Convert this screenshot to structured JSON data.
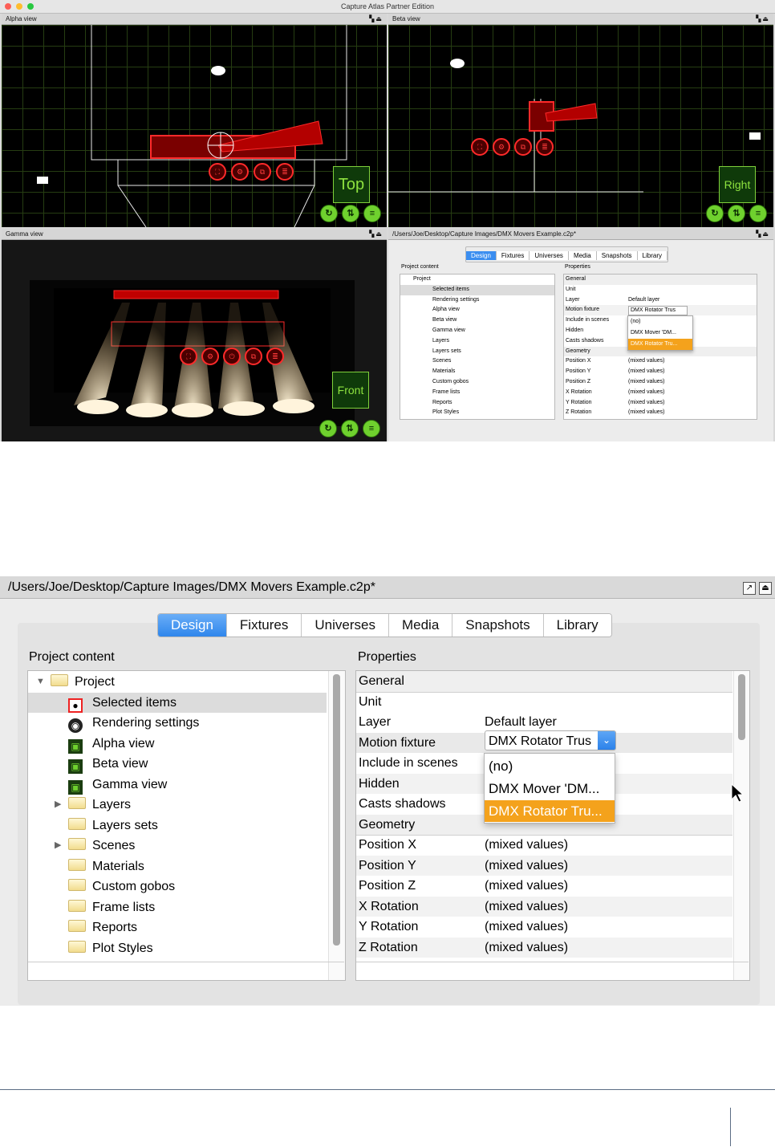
{
  "app": {
    "title": "Capture Atlas Partner Edition"
  },
  "views": {
    "alpha": {
      "header": "Alpha view",
      "label_button": "Top"
    },
    "beta": {
      "header": "Beta view",
      "label_button": "Right"
    },
    "gamma": {
      "header": "Gamma view",
      "label_button": "Front"
    },
    "project": {
      "header": "/Users/Joe/Desktop/Capture Images/DMX Movers Example.c2p*"
    }
  },
  "panel": {
    "title": "/Users/Joe/Desktop/Capture Images/DMX Movers Example.c2p*",
    "tabs": [
      "Design",
      "Fixtures",
      "Universes",
      "Media",
      "Snapshots",
      "Library"
    ],
    "active_tab": "Design",
    "project_content_label": "Project content",
    "properties_label": "Properties",
    "tree": [
      {
        "label": "Project",
        "icon": "folder-icon",
        "level": 0,
        "expanded": true
      },
      {
        "label": "Selected items",
        "icon": "selection-icon",
        "level": 1,
        "selected": true
      },
      {
        "label": "Rendering settings",
        "icon": "camera-lens-icon",
        "level": 1
      },
      {
        "label": "Alpha view",
        "icon": "view-icon",
        "level": 1
      },
      {
        "label": "Beta view",
        "icon": "view-icon",
        "level": 1
      },
      {
        "label": "Gamma view",
        "icon": "view-icon",
        "level": 1
      },
      {
        "label": "Layers",
        "icon": "folder-icon",
        "level": 1,
        "collapsed": true
      },
      {
        "label": "Layers sets",
        "icon": "folder-icon",
        "level": 1
      },
      {
        "label": "Scenes",
        "icon": "folder-icon",
        "level": 1,
        "collapsed": true
      },
      {
        "label": "Materials",
        "icon": "folder-icon",
        "level": 1
      },
      {
        "label": "Custom gobos",
        "icon": "folder-icon",
        "level": 1
      },
      {
        "label": "Frame lists",
        "icon": "folder-icon",
        "level": 1
      },
      {
        "label": "Reports",
        "icon": "folder-icon",
        "level": 1
      },
      {
        "label": "Plot Styles",
        "icon": "folder-icon",
        "level": 1
      }
    ],
    "properties": [
      {
        "key": "General",
        "value": "",
        "group": true
      },
      {
        "key": "Unit",
        "value": ""
      },
      {
        "key": "Layer",
        "value": "Default layer"
      },
      {
        "key": "Motion fixture",
        "value": ""
      },
      {
        "key": "Include in scenes",
        "value": ""
      },
      {
        "key": "Hidden",
        "value": ""
      },
      {
        "key": "Casts shadows",
        "value": ""
      },
      {
        "key": "Geometry",
        "value": "",
        "group": true
      },
      {
        "key": "Position X",
        "value": "(mixed values)"
      },
      {
        "key": "Position Y",
        "value": "(mixed values)"
      },
      {
        "key": "Position Z",
        "value": "(mixed values)"
      },
      {
        "key": "X Rotation",
        "value": "(mixed values)"
      },
      {
        "key": "Y Rotation",
        "value": "(mixed values)"
      },
      {
        "key": "Z Rotation",
        "value": "(mixed values)"
      }
    ],
    "motion_fixture_dropdown": {
      "value": "DMX Rotator Trus",
      "options": [
        "(no)",
        "DMX Mover 'DM...",
        "DMX Rotator Tru..."
      ],
      "highlighted_index": 2
    },
    "small_dropdown": {
      "value": "DMX Rotator Trus",
      "options": [
        "(no)",
        "DMX Mover 'DM...",
        "DMX Rotator Tru..."
      ]
    }
  },
  "colors": {
    "accent_blue": "#3b8ef0",
    "highlight_orange": "#f4a21c",
    "view_green": "#7fd13b",
    "selection_red": "#ff2a2a"
  }
}
